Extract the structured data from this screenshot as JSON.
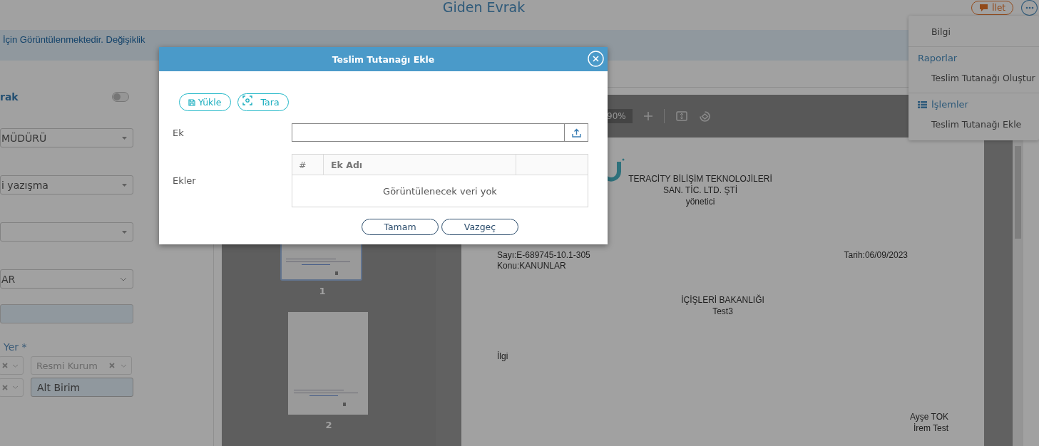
{
  "page_title": "Giden Evrak",
  "forward_button": {
    "label": "İlet"
  },
  "notice": "İçin Görüntülenmektedir. Değişiklik",
  "form": {
    "section_label": "rak",
    "toggle": {
      "on": false
    },
    "fields": [
      {
        "kind": "select",
        "value": "MÜDÜRÜ"
      },
      {
        "kind": "select",
        "value": "i yazışma"
      },
      {
        "kind": "select"
      },
      {
        "kind": "dropdown",
        "value": "AR"
      },
      {
        "kind": "input",
        "disabled": true
      }
    ],
    "recipient_label": "Yer *",
    "recipient_rows": [
      [
        {
          "kind": "clear-select"
        },
        {
          "kind": "clear-select",
          "placeholder": "Resmi Kurum"
        }
      ],
      [
        {
          "kind": "clear-select"
        },
        {
          "kind": "input",
          "disabled": true,
          "value": "Alt Birim"
        }
      ]
    ]
  },
  "viewer": {
    "zoom": "90%",
    "thumbnails": [
      {
        "label": "1",
        "selected": true
      },
      {
        "label": "2",
        "selected": false
      }
    ],
    "document": {
      "company_lines": [
        "TERACİTY BİLİŞİM TEKNOLOJİLERİ",
        "SAN. TİC. LTD. ŞTİ",
        "yönetici"
      ],
      "number": "Sayı:E-689745-10.1-305",
      "subject": "Konu:KANUNLAR",
      "date": "Tarih:06/09/2023",
      "addressee_lines": [
        "İÇİŞLERİ BAKANLIĞI",
        "Test3"
      ],
      "reference": "İlgi",
      "signers": [
        "Ayşe TOK",
        "İrem Test"
      ]
    }
  },
  "menu": {
    "items": [
      {
        "kind": "item",
        "label": "Bilgi"
      },
      {
        "kind": "header",
        "label": "Raporlar"
      },
      {
        "kind": "item",
        "label": "Teslim Tutanağı Oluştur"
      },
      {
        "kind": "icon-header",
        "label": "İşlemler"
      },
      {
        "kind": "item",
        "label": "Teslim Tutanağı Ekle"
      }
    ]
  },
  "dialog": {
    "title": "Teslim Tutanağı Ekle",
    "actions": [
      {
        "kind": "upload",
        "label": "Yükle"
      },
      {
        "kind": "scan",
        "label": "Tara"
      }
    ],
    "attachment_label": "Ek",
    "attachments_label": "Ekler",
    "table": {
      "columns": [
        "#",
        "Ek Adı"
      ],
      "empty_text": "Görüntülenecek veri yok"
    },
    "buttons": [
      {
        "label": "Tamam"
      },
      {
        "label": "Vazgeç"
      }
    ]
  }
}
